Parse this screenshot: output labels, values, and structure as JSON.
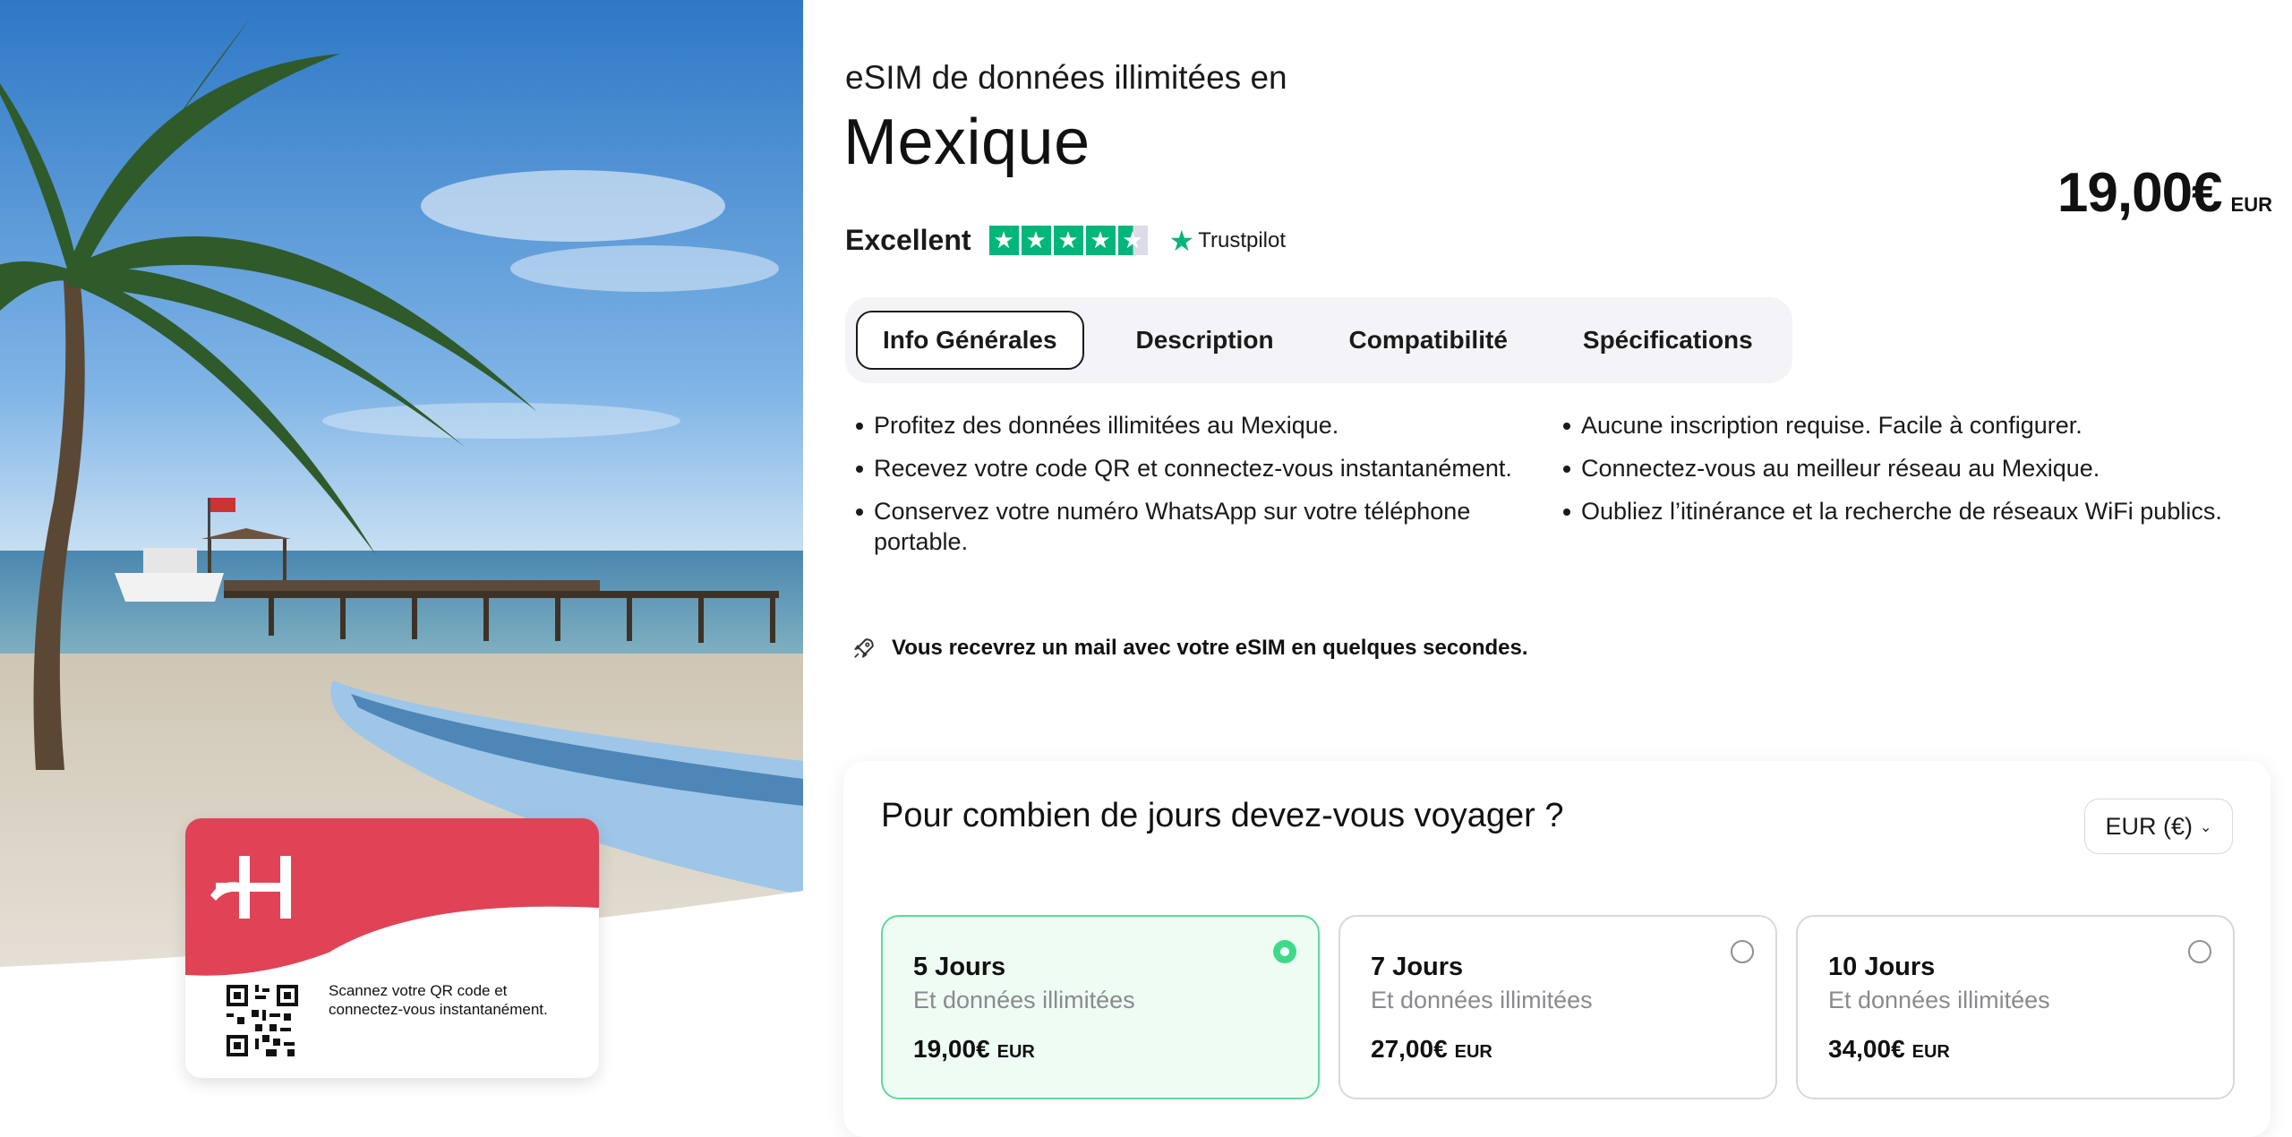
{
  "product": {
    "subtitle": "eSIM de données illimitées en",
    "title": "Mexique",
    "price": "19,00€",
    "currency_code": "EUR"
  },
  "rating": {
    "word": "Excellent",
    "stars": 4.5,
    "provider": "Trustpilot",
    "color": "#00b67a"
  },
  "tabs": [
    {
      "label": "Info Générales",
      "active": true
    },
    {
      "label": "Description",
      "active": false
    },
    {
      "label": "Compatibilité",
      "active": false
    },
    {
      "label": "Spécifications",
      "active": false
    }
  ],
  "features_left": [
    "Profitez des données illimitées au Mexique.",
    "Recevez votre code QR et connectez-vous instantanément.",
    "Conservez votre numéro WhatsApp sur votre téléphone portable."
  ],
  "features_right": [
    "Aucune inscription requise. Facile à configurer.",
    "Connectez-vous au meilleur réseau au Mexique.",
    "Oubliez l’itinérance et la recherche de réseaux WiFi publics."
  ],
  "note": {
    "icon": "rocket-icon",
    "text": "Vous recevrez un mail avec votre eSIM en quelques secondes."
  },
  "card": {
    "brand_color": "#e04356",
    "qr_text": "Scannez votre QR code et connectez-vous instantanément."
  },
  "booking": {
    "question": "Pour combien de jours devez-vous voyager ?",
    "currency_select": "EUR (€)",
    "plans": [
      {
        "days": "5 Jours",
        "desc": "Et données illimitées",
        "price": "19,00€",
        "currency": "EUR",
        "selected": true
      },
      {
        "days": "7 Jours",
        "desc": "Et données illimitées",
        "price": "27,00€",
        "currency": "EUR",
        "selected": false
      },
      {
        "days": "10 Jours",
        "desc": "Et données illimitées",
        "price": "34,00€",
        "currency": "EUR",
        "selected": false
      }
    ]
  },
  "accent_green": "#3fd98a"
}
